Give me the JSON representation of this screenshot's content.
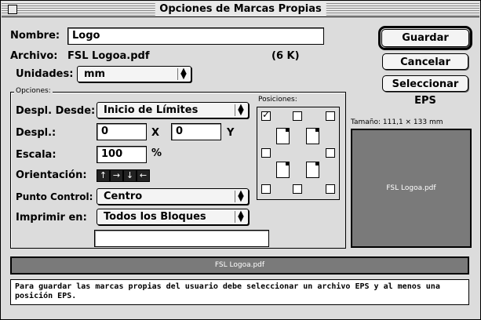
{
  "window": {
    "title": "Opciones de Marcas Propias"
  },
  "form": {
    "nombre_label": "Nombre:",
    "nombre_value": "Logo",
    "archivo_label": "Archivo:",
    "archivo_value": "FSL Logoa.pdf",
    "archivo_size": "(6 K)",
    "unidades_label": "Unidades:",
    "unidades_value": "mm"
  },
  "buttons": {
    "guardar": "Guardar",
    "cancelar": "Cancelar",
    "seleccionar": "Seleccionar EPS"
  },
  "opciones": {
    "group_label": "Opciones:",
    "despl_desde_label": "Despl. Desde:",
    "despl_desde_value": "Inicio de Límites",
    "despl_label": "Despl.:",
    "despl_x": "0",
    "x_label": "X",
    "despl_y": "0",
    "y_label": "Y",
    "escala_label": "Escala:",
    "escala_value": "100",
    "escala_unit": "%",
    "orientacion_label": "Orientación:",
    "orientation_buttons": [
      "↑",
      "→",
      "↓",
      "←"
    ],
    "punto_control_label": "Punto Control:",
    "punto_control_value": "Centro",
    "imprimir_label": "Imprimir en:",
    "imprimir_value": "Todos los Bloques",
    "extra_field": ""
  },
  "posiciones": {
    "label": "Posiciones:"
  },
  "preview": {
    "size_label": "Tamaño: 111,1 × 133 mm",
    "filename": "FSL Logoa.pdf"
  },
  "bar": {
    "filename": "FSL Logoa.pdf"
  },
  "message": "Para guardar las marcas propias del usuario debe seleccionar un archivo EPS y al menos una posición EPS."
}
